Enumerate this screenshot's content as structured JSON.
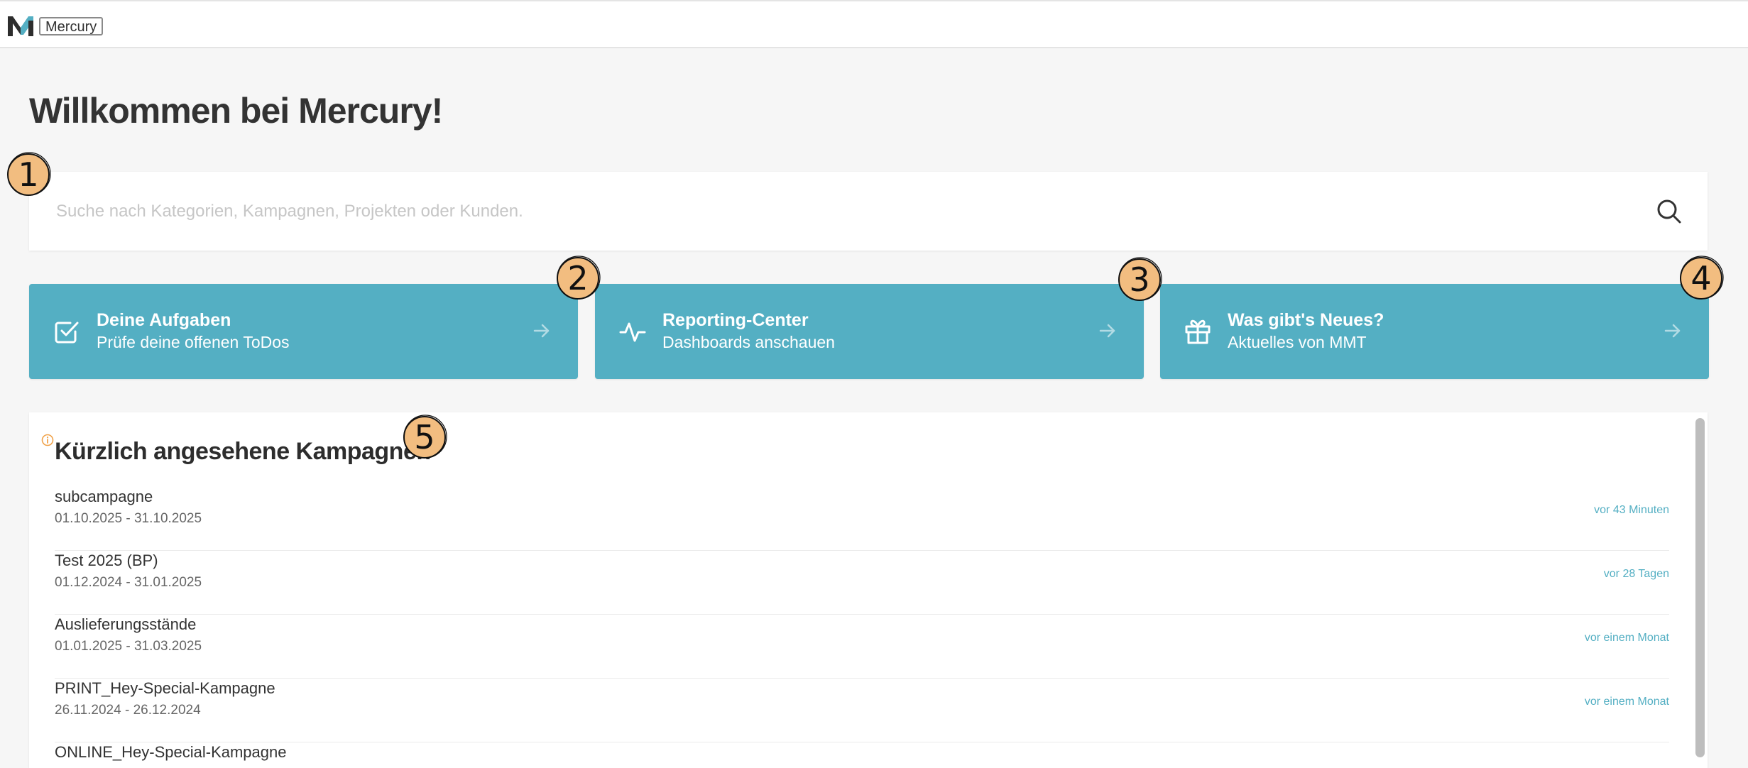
{
  "header": {
    "app_name": "Mercury",
    "logo_icon": "mercury-m-logo"
  },
  "page": {
    "title": "Willkommen bei Mercury!"
  },
  "search": {
    "placeholder": "Suche nach Kategorien, Kampagnen, Projekten oder Kunden.",
    "icon": "search-icon"
  },
  "cards": [
    {
      "title": "Deine Aufgaben",
      "subtitle": "Prüfe deine offenen ToDos",
      "icon": "checkbox-icon"
    },
    {
      "title": "Reporting-Center",
      "subtitle": "Dashboards anschauen",
      "icon": "activity-icon"
    },
    {
      "title": "Was gibt's Neues?",
      "subtitle": "Aktuelles von MMT",
      "icon": "gift-icon"
    }
  ],
  "badges": [
    "1",
    "2",
    "3",
    "4",
    "5"
  ],
  "recent": {
    "title": "Kürzlich angesehene Kampagnen",
    "items": [
      {
        "name": "subcampagne",
        "dates": "01.10.2025 - 31.10.2025",
        "time": "vor 43 Minuten"
      },
      {
        "name": "Test 2025 (BP)",
        "dates": "01.12.2024 - 31.01.2025",
        "time": "vor 28 Tagen"
      },
      {
        "name": "Auslieferungsstände",
        "dates": "01.01.2025 - 31.03.2025",
        "time": "vor einem Monat"
      },
      {
        "name": "PRINT_Hey-Special-Kampagne",
        "dates": "26.11.2024 - 26.12.2024",
        "time": "vor einem Monat"
      },
      {
        "name": "ONLINE_Hey-Special-Kampagne",
        "dates": "",
        "time": ""
      }
    ]
  },
  "colors": {
    "accent": "#54afc3",
    "background": "#f6f6f6",
    "badge_fill": "#f2bd80",
    "logo_accent": "#54afc3",
    "logo_dark": "#2d2d2d"
  }
}
